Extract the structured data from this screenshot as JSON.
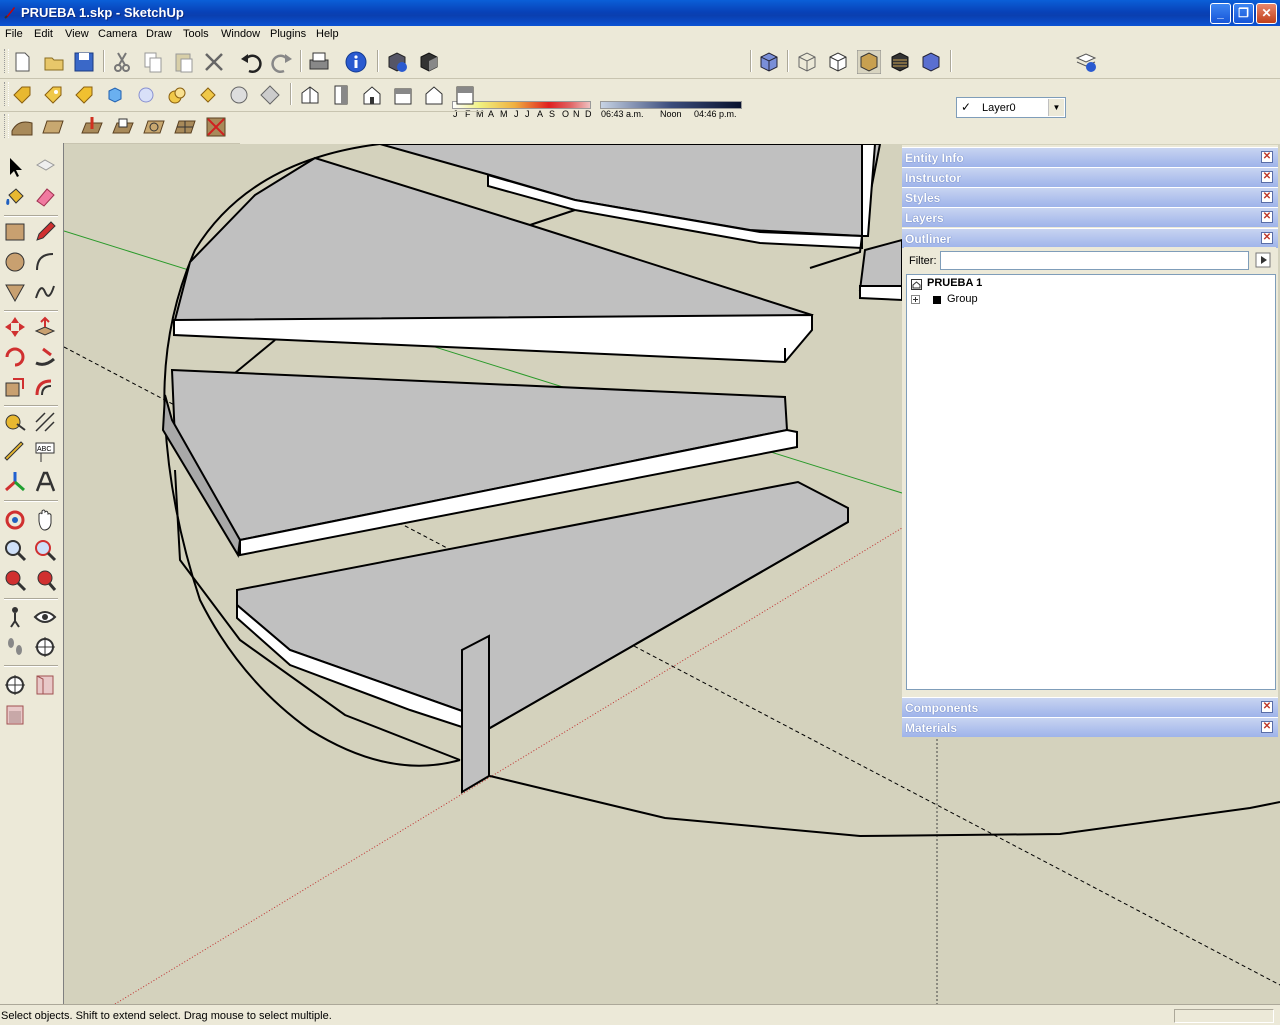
{
  "window": {
    "title": "PRUEBA 1.skp - SketchUp"
  },
  "menu": [
    "File",
    "Edit",
    "View",
    "Camera",
    "Draw",
    "Tools",
    "Window",
    "Plugins",
    "Help"
  ],
  "shadows": {
    "months": [
      "J",
      "F",
      "M",
      "A",
      "M",
      "J",
      "J",
      "A",
      "S",
      "O",
      "N",
      "D"
    ],
    "time_start": "06:43 a.m.",
    "time_mid": "Noon",
    "time_end": "04:46 p.m."
  },
  "layer": {
    "current": "Layer0"
  },
  "tray": {
    "panels_top": [
      "Entity Info",
      "Instructor",
      "Styles",
      "Layers",
      "Outliner"
    ],
    "panels_bottom": [
      "Components",
      "Materials"
    ],
    "outliner": {
      "filter_label": "Filter:",
      "filter_value": "",
      "root": "PRUEBA 1",
      "child": "Group"
    }
  },
  "status": {
    "text": "Select objects. Shift to extend select. Drag mouse to select multiple."
  }
}
